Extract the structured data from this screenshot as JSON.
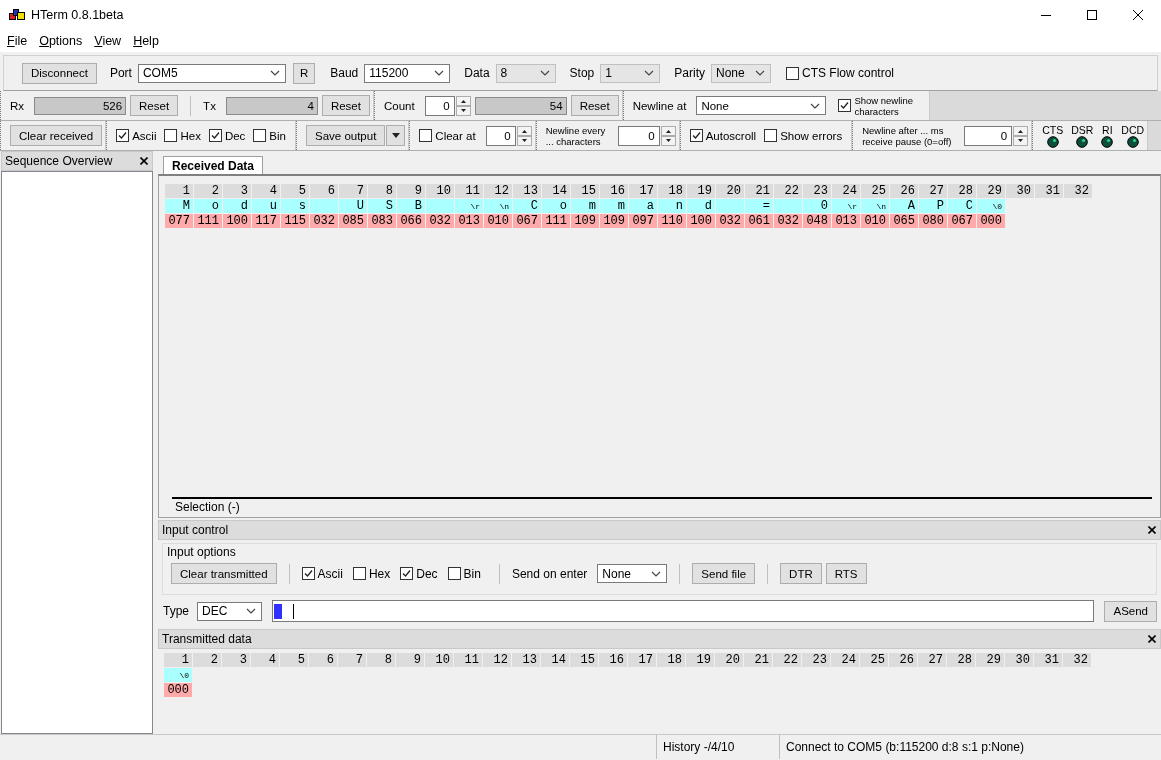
{
  "window": {
    "title": "HTerm 0.8.1beta"
  },
  "menu": [
    {
      "label": "File"
    },
    {
      "label": "Options"
    },
    {
      "label": "View"
    },
    {
      "label": "Help"
    }
  ],
  "connection": {
    "connect_button": "Disconnect",
    "port": {
      "label": "Port",
      "value": "COM5",
      "disabled": false
    },
    "refresh_button": "R",
    "baud": {
      "label": "Baud",
      "value": "115200",
      "disabled": false
    },
    "data": {
      "label": "Data",
      "value": "8",
      "disabled": true
    },
    "stop": {
      "label": "Stop",
      "value": "1",
      "disabled": true
    },
    "parity": {
      "label": "Parity",
      "value": "None",
      "disabled": true
    },
    "cts_flow": {
      "label": "CTS Flow control",
      "checked": false
    }
  },
  "counters": {
    "rx": {
      "label": "Rx",
      "value": "526"
    },
    "rx_reset": "Reset",
    "tx": {
      "label": "Tx",
      "value": "4"
    },
    "tx_reset": "Reset",
    "count": {
      "label": "Count",
      "value": "0"
    },
    "count_total": "54",
    "count_reset": "Reset",
    "newline_at": {
      "label": "Newline at",
      "value": "None"
    },
    "show_newline": {
      "label": "Show newline characters",
      "checked": true
    }
  },
  "display": {
    "clear_button": "Clear received",
    "formats": [
      {
        "label": "Ascii",
        "checked": true
      },
      {
        "label": "Hex",
        "checked": false
      },
      {
        "label": "Dec",
        "checked": true
      },
      {
        "label": "Bin",
        "checked": false
      }
    ],
    "save_button": "Save output",
    "clear_at": {
      "label": "Clear at",
      "checked": false,
      "value": "0"
    },
    "newline_every": {
      "label": "Newline every ... characters",
      "value": "0"
    },
    "autoscroll": {
      "label": "Autoscroll",
      "checked": true
    },
    "show_errors": {
      "label": "Show errors",
      "checked": false
    },
    "newline_after": {
      "label": "Newline after ... ms receive pause (0=off)",
      "value": "0"
    },
    "signals": [
      {
        "label": "CTS",
        "on": false
      },
      {
        "label": "DSR",
        "on": false
      },
      {
        "label": "RI",
        "on": false
      },
      {
        "label": "DCD",
        "on": false
      }
    ]
  },
  "sequence_overview": {
    "title": "Sequence Overview"
  },
  "received": {
    "tab": "Received Data",
    "columns": [
      "1",
      "2",
      "3",
      "4",
      "5",
      "6",
      "7",
      "8",
      "9",
      "10",
      "11",
      "12",
      "13",
      "14",
      "15",
      "16",
      "17",
      "18",
      "19",
      "20",
      "21",
      "22",
      "23",
      "24",
      "25",
      "26",
      "27",
      "28",
      "29",
      "30",
      "31",
      "32"
    ],
    "bytes": [
      {
        "kind": "char",
        "ascii": "M",
        "dec": "077"
      },
      {
        "kind": "char",
        "ascii": "o",
        "dec": "111"
      },
      {
        "kind": "char",
        "ascii": "d",
        "dec": "100"
      },
      {
        "kind": "char",
        "ascii": "u",
        "dec": "117"
      },
      {
        "kind": "char",
        "ascii": "s",
        "dec": "115"
      },
      {
        "kind": "space",
        "dec": "032"
      },
      {
        "kind": "char",
        "ascii": "U",
        "dec": "085"
      },
      {
        "kind": "char",
        "ascii": "S",
        "dec": "083"
      },
      {
        "kind": "char",
        "ascii": "B",
        "dec": "066"
      },
      {
        "kind": "space",
        "dec": "032"
      },
      {
        "kind": "control",
        "ascii": "\\r",
        "dec": "013"
      },
      {
        "kind": "control",
        "ascii": "\\n",
        "dec": "010"
      },
      {
        "kind": "char",
        "ascii": "C",
        "dec": "067"
      },
      {
        "kind": "char",
        "ascii": "o",
        "dec": "111"
      },
      {
        "kind": "char",
        "ascii": "m",
        "dec": "109"
      },
      {
        "kind": "char",
        "ascii": "m",
        "dec": "109"
      },
      {
        "kind": "char",
        "ascii": "a",
        "dec": "097"
      },
      {
        "kind": "char",
        "ascii": "n",
        "dec": "110"
      },
      {
        "kind": "char",
        "ascii": "d",
        "dec": "100"
      },
      {
        "kind": "space",
        "dec": "032"
      },
      {
        "kind": "char",
        "ascii": "=",
        "dec": "061"
      },
      {
        "kind": "space",
        "dec": "032"
      },
      {
        "kind": "char",
        "ascii": "0",
        "dec": "048"
      },
      {
        "kind": "control",
        "ascii": "\\r",
        "dec": "013"
      },
      {
        "kind": "control",
        "ascii": "\\n",
        "dec": "010"
      },
      {
        "kind": "char",
        "ascii": "A",
        "dec": "065"
      },
      {
        "kind": "char",
        "ascii": "P",
        "dec": "080"
      },
      {
        "kind": "char",
        "ascii": "C",
        "dec": "067"
      },
      {
        "kind": "control",
        "ascii": "\\0",
        "dec": "000"
      }
    ],
    "selection": "Selection (-)"
  },
  "input_control": {
    "title": "Input control",
    "options_label": "Input options",
    "clear_button": "Clear transmitted",
    "formats": [
      {
        "label": "Ascii",
        "checked": true
      },
      {
        "label": "Hex",
        "checked": false
      },
      {
        "label": "Dec",
        "checked": true
      },
      {
        "label": "Bin",
        "checked": false
      }
    ],
    "send_on_enter": {
      "label": "Send on enter",
      "value": "None"
    },
    "send_file_button": "Send file",
    "dtr_button": "DTR",
    "rts_button": "RTS",
    "type": {
      "label": "Type",
      "value": "DEC"
    },
    "send_button": "ASend"
  },
  "transmitted": {
    "title": "Transmitted data",
    "columns": [
      "1",
      "2",
      "3",
      "4",
      "5",
      "6",
      "7",
      "8",
      "9",
      "10",
      "11",
      "12",
      "13",
      "14",
      "15",
      "16",
      "17",
      "18",
      "19",
      "20",
      "21",
      "22",
      "23",
      "24",
      "25",
      "26",
      "27",
      "28",
      "29",
      "30",
      "31",
      "32"
    ],
    "bytes": [
      {
        "kind": "control",
        "ascii": "\\0",
        "dec": "000"
      }
    ]
  },
  "status": {
    "history": "History -/4/10",
    "connection": "Connect to COM5 (b:115200 d:8 s:1 p:None)"
  }
}
